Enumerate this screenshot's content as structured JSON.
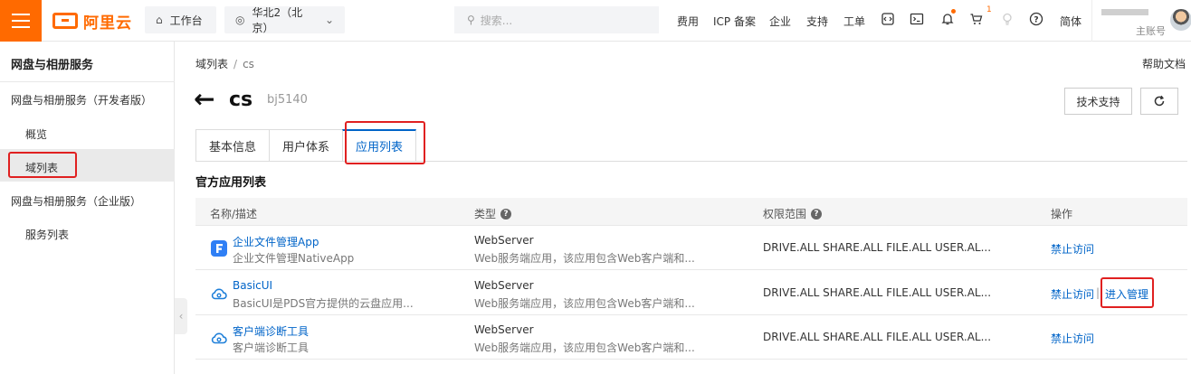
{
  "topbar": {
    "logo_text": "阿里云",
    "workbench": "工作台",
    "region": "华北2（北京）",
    "search_placeholder": "搜索...",
    "nav": [
      "费用",
      "ICP 备案",
      "企业",
      "支持",
      "工单"
    ],
    "cart_count": "1",
    "lang": "简体",
    "account_sub": "主账号"
  },
  "sidebar": {
    "title": "网盘与相册服务",
    "groups": [
      {
        "label": "网盘与相册服务（开发者版）",
        "items": [
          "概览",
          "域列表"
        ]
      },
      {
        "label": "网盘与相册服务（企业版）",
        "items": [
          "服务列表"
        ]
      }
    ]
  },
  "main": {
    "breadcrumb": [
      "域列表",
      "cs"
    ],
    "help": "帮助文档",
    "title": "cs",
    "subtitle": "bj5140",
    "support_button": "技术支持",
    "tabs": [
      "基本信息",
      "用户体系",
      "应用列表"
    ],
    "section_title": "官方应用列表",
    "table": {
      "headers": [
        "名称/描述",
        "类型",
        "权限范围",
        "操作"
      ],
      "rows": [
        {
          "name": "企业文件管理App",
          "desc": "企业文件管理NativeApp",
          "type": "WebServer",
          "type_desc": "Web服务端应用，该应用包含Web客户端和...",
          "scope": "DRIVE.ALL SHARE.ALL FILE.ALL USER.AL...",
          "ops": [
            "禁止访问"
          ]
        },
        {
          "name": "BasicUI",
          "desc": "BasicUI是PDS官方提供的云盘应用...",
          "type": "WebServer",
          "type_desc": "Web服务端应用，该应用包含Web客户端和...",
          "scope": "DRIVE.ALL SHARE.ALL FILE.ALL USER.AL...",
          "ops": [
            "禁止访问",
            "进入管理"
          ]
        },
        {
          "name": "客户端诊断工具",
          "desc": "客户端诊断工具",
          "type": "WebServer",
          "type_desc": "Web服务端应用，该应用包含Web客户端和...",
          "scope": "DRIVE.ALL SHARE.ALL FILE.ALL USER.AL...",
          "ops": [
            "禁止访问"
          ]
        }
      ]
    }
  },
  "colors": {
    "brand": "#ff6a00",
    "link": "#0064c8",
    "highlight": "#e02020"
  }
}
